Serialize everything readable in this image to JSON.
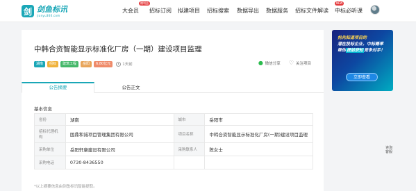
{
  "header": {
    "logo": {
      "mark": "剑",
      "name": "剑鱼标讯",
      "domain": "jianyu360.com"
    },
    "nav": [
      {
        "label": "大会员",
        "badge": "赠利益"
      },
      {
        "label": "招标订阅",
        "badge": ""
      },
      {
        "label": "拟建项目",
        "badge": ""
      },
      {
        "label": "招标搜索",
        "badge": ""
      },
      {
        "label": "数据导出",
        "badge": ""
      },
      {
        "label": "数据服务",
        "badge": ""
      },
      {
        "label": "招标文件解读",
        "badge": "NEW"
      },
      {
        "label": "中标必听课",
        "badge": ""
      }
    ]
  },
  "notice": {
    "title": "中韩合资智能显示标准化厂房（一期）建设项目监理",
    "tags": [
      {
        "label": "湖南",
        "color": "#1aa7b7"
      },
      {
        "label": "招标",
        "color": "#f0b23b"
      },
      {
        "label": "建筑工程",
        "color": "#45b86a"
      },
      {
        "label": "岳阳",
        "color": "#e8a55a"
      },
      {
        "label": "6.80亿元",
        "color": "#ef8b6a"
      }
    ],
    "time": "1天前",
    "actions": {
      "share": "微信分享",
      "follow": "关注项目"
    },
    "tabs": [
      "公告摘要",
      "公告正文"
    ],
    "section_title": "基本信息",
    "info": {
      "province_label": "省份",
      "province": "湖南",
      "city_label": "城市",
      "city": "岳阳市",
      "agency_label": "招标代理机构",
      "agency": "国鼎和诚项目管理集团有限公司",
      "project_label": "项目名称",
      "project": "中韩合资智能显示标准化厂房(一期)建设项目监理",
      "buyer_label": "采购单位",
      "buyer": "岳阳轩康建设有限公司",
      "contact_label": "采购联系人",
      "contact": "陈女士",
      "phone_label": "采购电话",
      "phone": "0730-8436550"
    },
    "footnote": "*以上摘要信息由剑鱼标讯智能提取。"
  },
  "banner": {
    "line1": "抢先知道项目的",
    "line2": "潜在投标企业，中标概率",
    "line3_pre": "帮你",
    "line3_hl": "提前获知",
    "line3_post": "竞争对手！",
    "button": "立即查看"
  },
  "consult": "咨询客服"
}
